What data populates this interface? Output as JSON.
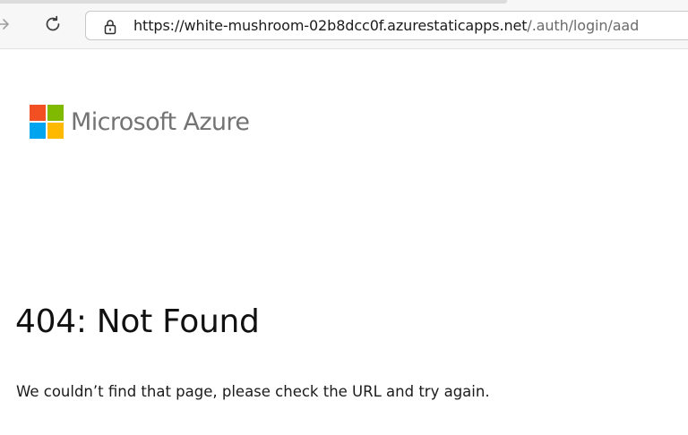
{
  "browser": {
    "url_host": "https://white-mushroom-02b8dcc0f.azurestaticapps.net",
    "url_path": "/.auth/login/aad",
    "icons": {
      "forward": "arrow-right-icon",
      "reload": "reload-icon",
      "lock": "lock-icon"
    }
  },
  "page": {
    "brand_name": "Microsoft Azure",
    "logo_colors": [
      "#f25022",
      "#7fba00",
      "#00a4ef",
      "#ffb900"
    ],
    "title": "404: Not Found",
    "message": "We couldn’t find that page, please check the URL and try again."
  }
}
